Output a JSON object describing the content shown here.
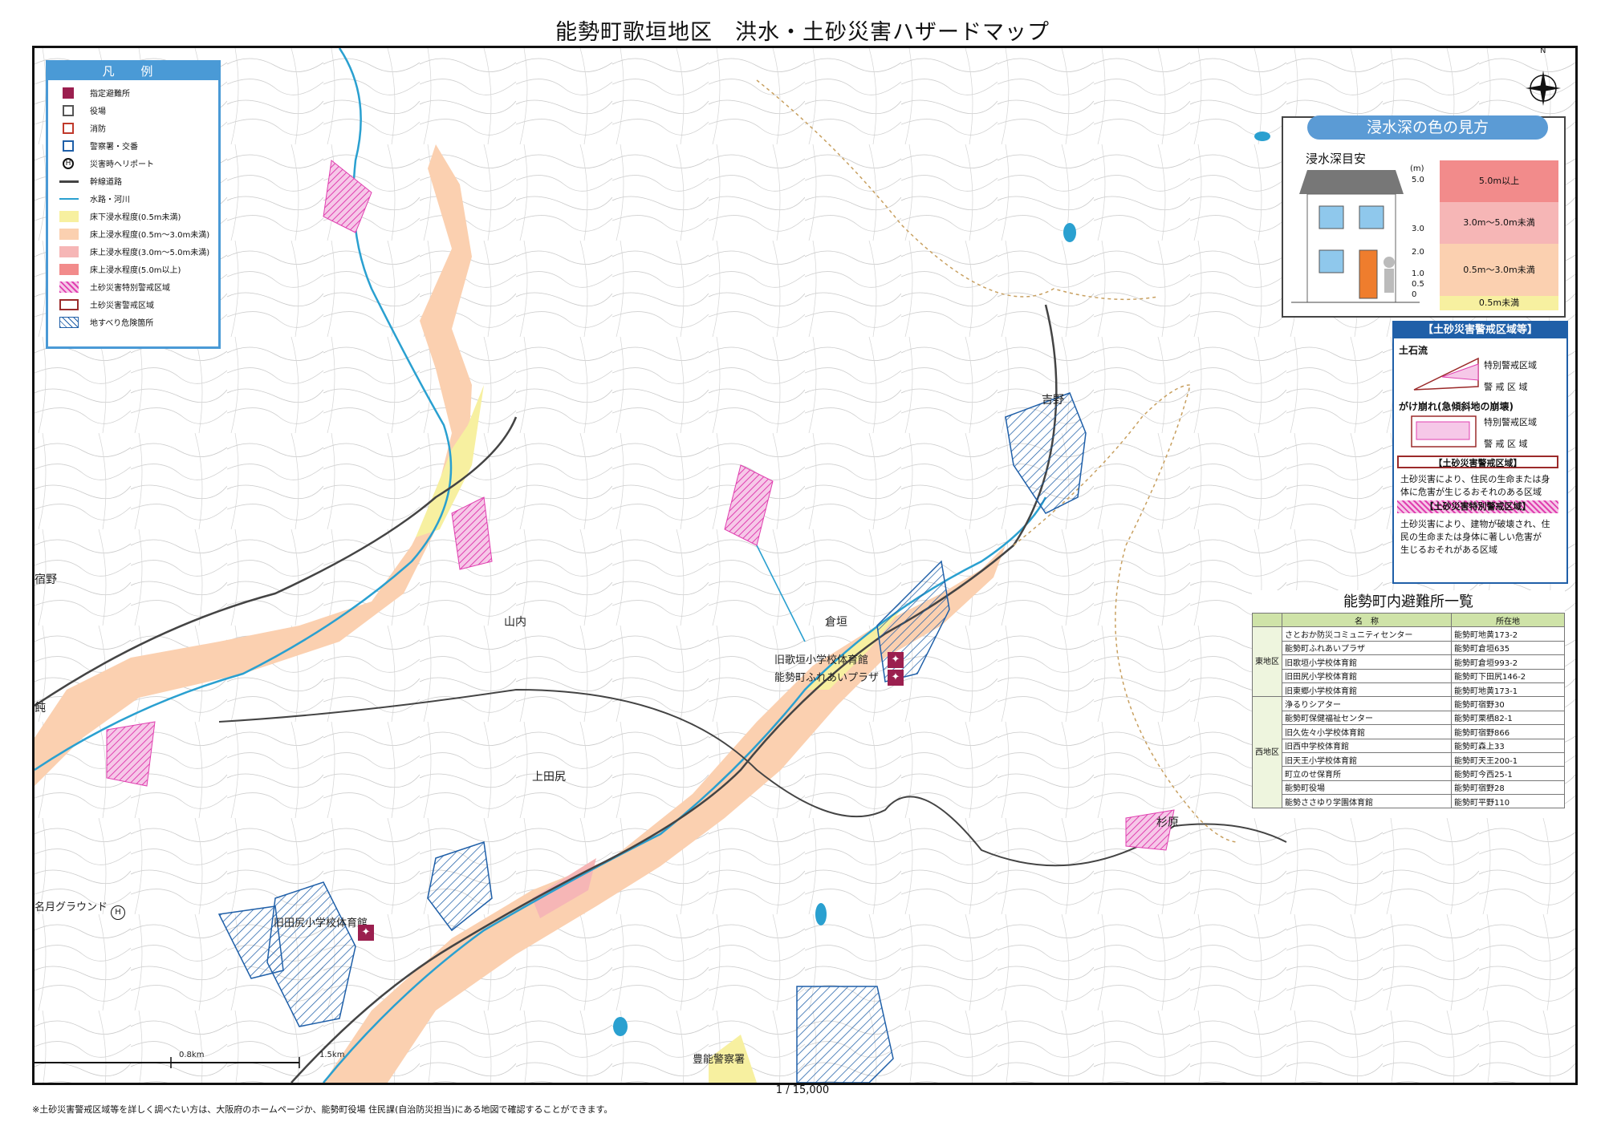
{
  "title": "能勢町歌垣地区　洪水・土砂災害ハザードマップ",
  "scale_text": "1 / 15,000",
  "footnote": "※土砂災害警戒区域等を詳しく調べたい方は、大阪府のホームページか、能勢町役場 住民課(自治防災担当)にある地図で確認することができます。",
  "compass_label": "N",
  "legend": {
    "title": "凡 例",
    "items": [
      {
        "label": "指定避難所",
        "icon": "shelter-icon",
        "color": "#9b1f4f"
      },
      {
        "label": "役場",
        "icon": "town-hall-icon",
        "color": "#555555"
      },
      {
        "label": "消防",
        "icon": "fire-station-icon",
        "color": "#c0392b"
      },
      {
        "label": "警察署・交番",
        "icon": "police-icon",
        "color": "#1f5fa8"
      },
      {
        "label": "災害時ヘリポート",
        "icon": "heliport-icon",
        "color": "#111111"
      },
      {
        "label": "幹線道路",
        "icon": "road-line",
        "color": "#444444"
      },
      {
        "label": "水路・河川",
        "icon": "river-line",
        "color": "#2aa0d0"
      },
      {
        "label": "床下浸水程度(0.5m未満)",
        "icon": "swatch",
        "color": "#f7f0a0"
      },
      {
        "label": "床上浸水程度(0.5m～3.0m未満)",
        "icon": "swatch",
        "color": "#fbd0b0"
      },
      {
        "label": "床上浸水程度(3.0m～5.0m未満)",
        "icon": "swatch",
        "color": "#f6b6b6"
      },
      {
        "label": "床上浸水程度(5.0m以上)",
        "icon": "swatch",
        "color": "#f28b8b"
      },
      {
        "label": "土砂災害特別警戒区域",
        "icon": "hatch-swatch",
        "color": "#e040b0"
      },
      {
        "label": "土砂災害警戒区域",
        "icon": "outline-swatch",
        "color": "#9b2a2a"
      },
      {
        "label": "地すべり危険箇所",
        "icon": "diag-swatch",
        "color": "#1f5fa8"
      }
    ]
  },
  "depth_panel": {
    "title": "浸水深の色の見方",
    "subtitle": "浸水深目安",
    "unit": "(m)",
    "ticks": [
      "5.0",
      "3.0",
      "2.0",
      "1.0",
      "0.5",
      "0"
    ],
    "bands": [
      {
        "label": "5.0m以上",
        "color": "#f28b8b"
      },
      {
        "label": "3.0m～5.0m未満",
        "color": "#f6b6b6"
      },
      {
        "label": "0.5m～3.0m未満",
        "color": "#fbd0b0"
      },
      {
        "label": "0.5m未満",
        "color": "#f7f0a0"
      }
    ]
  },
  "sediment_panel": {
    "title": "【土砂災害警戒区域等】",
    "debris_flow": "土石流",
    "slope_failure": "がけ崩れ(急傾斜地の崩壊)",
    "special_zone_label": "特別警戒区域",
    "warning_zone_label": "警 戒 区 域",
    "warning_head": "【土砂災害警戒区域】",
    "warning_text": [
      "土砂災害により、住民の生命または身",
      "体に危害が生じるおそれのある区域"
    ],
    "special_head": "【土砂災害特別警戒区域】",
    "special_text": [
      "土砂災害により、建物が破壊され、住",
      "民の生命または身体に著しい危害が",
      "生じるおそれがある区域"
    ]
  },
  "shelters": {
    "title": "能勢町内避難所一覧",
    "col_name": "名　称",
    "col_address": "所在地",
    "east_label": "東地区",
    "west_label": "西地区",
    "east": [
      {
        "name": "さとおか防災コミュニティセンター",
        "address": "能勢町地黄173-2"
      },
      {
        "name": "能勢町ふれあいプラザ",
        "address": "能勢町倉垣635"
      },
      {
        "name": "旧歌垣小学校体育館",
        "address": "能勢町倉垣993-2"
      },
      {
        "name": "旧田尻小学校体育館",
        "address": "能勢町下田尻146-2"
      },
      {
        "name": "旧東郷小学校体育館",
        "address": "能勢町地黄173-1"
      }
    ],
    "west": [
      {
        "name": "浄るりシアター",
        "address": "能勢町宿野30"
      },
      {
        "name": "能勢町保健福祉センター",
        "address": "能勢町栗栖82-1"
      },
      {
        "name": "旧久佐々小学校体育館",
        "address": "能勢町宿野866"
      },
      {
        "name": "旧西中学校体育館",
        "address": "能勢町森上33"
      },
      {
        "name": "旧天王小学校体育館",
        "address": "能勢町天王200-1"
      },
      {
        "name": "町立のせ保育所",
        "address": "能勢町今西25-1"
      },
      {
        "name": "能勢町役場",
        "address": "能勢町宿野28"
      },
      {
        "name": "能勢ささゆり学園体育館",
        "address": "能勢町平野110"
      }
    ]
  },
  "places": {
    "shukuno": "宿野",
    "yamauchi": "山内",
    "kuragaki": "倉垣",
    "kamitajiri": "上田尻",
    "yoshino": "吉野",
    "sugihara": "杉原",
    "meigetsu": "名月グラウンド",
    "toyono_police": "豊能警察署",
    "utagaki_school": "旧歌垣小学校体育館",
    "fureai": "能勢町ふれあいプラザ",
    "tajiri_school": "旧田尻小学校体育館",
    "scale_08": "0.8km",
    "scale_15": "1.5km",
    "edge_ji": "飩"
  }
}
